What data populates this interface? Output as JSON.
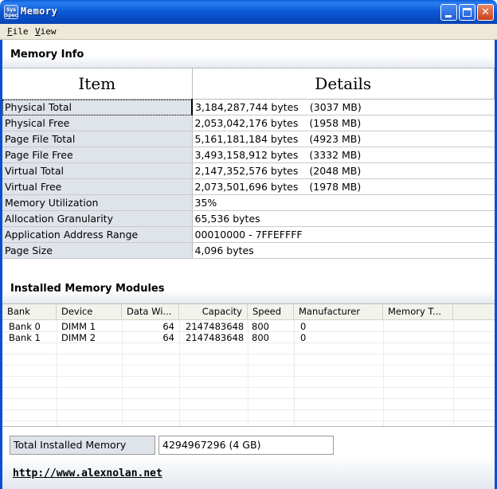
{
  "window": {
    "title": "Memory",
    "icon_text": "Sys Spec",
    "minimize": "minimize",
    "maximize": "maximize",
    "close": "✕"
  },
  "menu": {
    "file": {
      "key": "F",
      "rest": "ile"
    },
    "view": {
      "key": "V",
      "rest": "iew"
    }
  },
  "memory_info": {
    "header": "Memory Info",
    "col_item": "Item",
    "col_details": "Details",
    "rows": [
      {
        "item": "Physical Total",
        "detail": "3,184,287,744 bytes",
        "mb": "(3037 MB)"
      },
      {
        "item": "Physical Free",
        "detail": "2,053,042,176 bytes",
        "mb": "(1958 MB)"
      },
      {
        "item": "Page File Total",
        "detail": "5,161,181,184 bytes",
        "mb": "(4923 MB)"
      },
      {
        "item": "Page File Free",
        "detail": "3,493,158,912 bytes",
        "mb": "(3332 MB)"
      },
      {
        "item": "Virtual Total",
        "detail": "2,147,352,576 bytes",
        "mb": "(2048 MB)"
      },
      {
        "item": "Virtual Free",
        "detail": "2,073,501,696 bytes",
        "mb": "(1978 MB)"
      },
      {
        "item": "Memory Utilization",
        "detail": "35%",
        "mb": ""
      },
      {
        "item": "Allocation Granularity",
        "detail": "65,536 bytes",
        "mb": ""
      },
      {
        "item": "Application Address Range",
        "detail": "00010000 - 7FFEFFFF",
        "mb": ""
      },
      {
        "item": "Page Size",
        "detail": "4,096 bytes",
        "mb": ""
      }
    ]
  },
  "modules": {
    "header": "Installed Memory Modules",
    "columns": [
      "Bank",
      "Device",
      "Data Wi...",
      "Capacity",
      "Speed",
      "Manufacturer",
      "Memory T..."
    ],
    "rows": [
      {
        "bank": "Bank 0",
        "device": "DIMM 1",
        "data_width": "64",
        "capacity": "2147483648",
        "speed": "800",
        "manufacturer": "0"
      },
      {
        "bank": "Bank 1",
        "device": "DIMM 2",
        "data_width": "64",
        "capacity": "2147483648",
        "speed": "800",
        "manufacturer": "0"
      }
    ]
  },
  "total": {
    "label": "Total Installed Memory",
    "value": "4294967296 (4 GB)"
  },
  "link": "http://www.alexnolan.net"
}
